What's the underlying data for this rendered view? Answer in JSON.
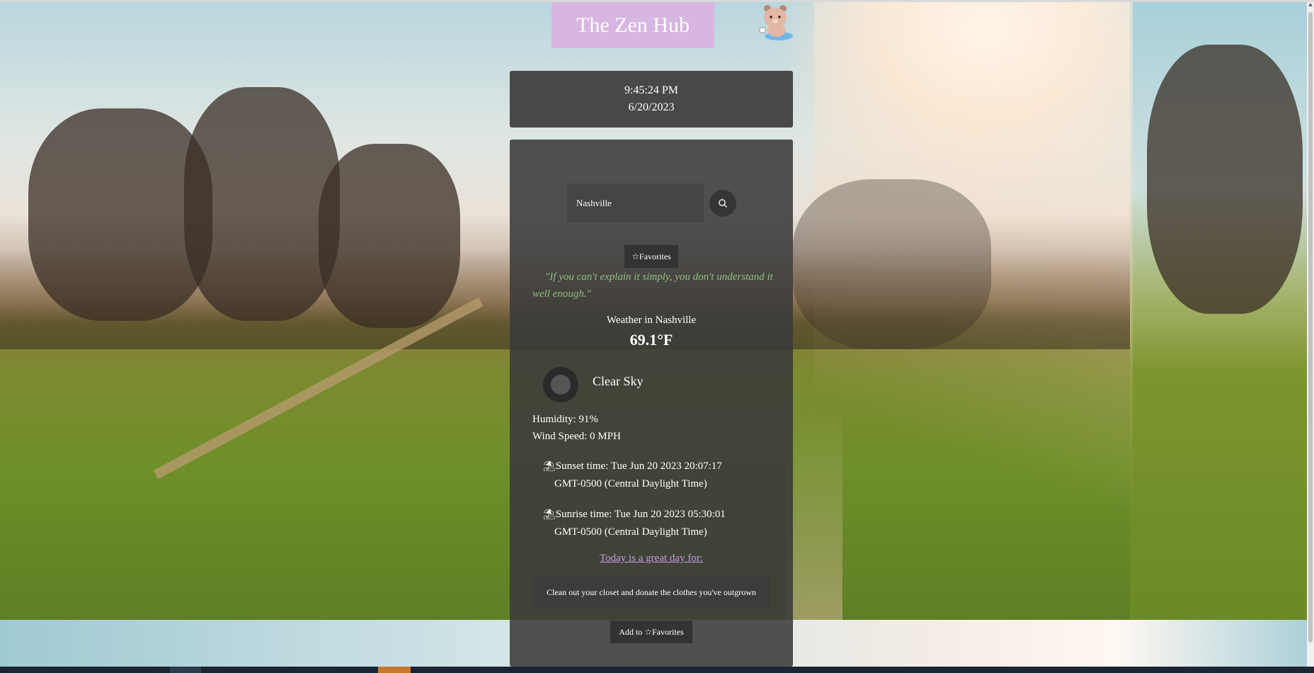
{
  "header": {
    "title": "The Zen Hub",
    "mascot_icon": "bear-mascot-icon"
  },
  "clock": {
    "time": "9:45:24 PM",
    "date": "6/20/2023"
  },
  "search": {
    "value": "Nashville",
    "button_icon": "search-icon"
  },
  "favorites_button": "☆Favorites",
  "quote": "\"If you can't explain it simply, you don't understand it well enough.\"",
  "weather": {
    "heading": "Weather in Nashville",
    "temperature": "69.1°F",
    "description": "Clear Sky",
    "humidity": "Humidity: 91%",
    "wind": "Wind Speed: 0 MPH",
    "sunset_icon": "⛱",
    "sunset_line1": "Sunset time: Tue Jun 20 2023 20:07:17",
    "sunset_line2": "GMT-0500 (Central Daylight Time)",
    "sunrise_icon": "⛱",
    "sunrise_line1": "Sunrise time: Tue Jun 20 2023 05:30:01",
    "sunrise_line2": "GMT-0500 (Central Daylight Time)"
  },
  "activity": {
    "link": "Today is a great day for:",
    "suggestion": "Clean out your closet and donate the clothes you've outgrown",
    "add_button": "Add to ☆Favorites"
  },
  "colors": {
    "title_bg": "#d8b6e2",
    "panel_bg": "#3a3a3a",
    "quote": "#8fbf7f",
    "link": "#c79be0"
  }
}
